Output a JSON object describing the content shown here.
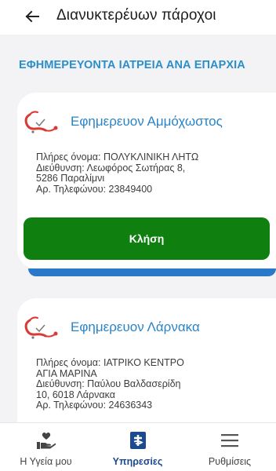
{
  "header": {
    "title": "Διανυκτερέυων πάροχοι"
  },
  "section": {
    "title": "ΕΦΗΜΕΡΕΥΟΝΤΑ ΙΑΤΡΕΙΑ ΑΝΑ ΕΠΑΡΧΙΑ"
  },
  "providers": [
    {
      "title": "Εφημερευον Αμμόχωστος",
      "info": [
        "Πλήρες όνομα: ΠΟΛΥΚΛΙΝΙΚΗ ΛΗΤΩ",
        "Διεύθυνση: Λεωφόρος Σωτήρας 8,",
        "5286 Παραλίμνι",
        "Αρ. Τηλεφώνου: 23849400"
      ],
      "call_label": "Κλήση"
    },
    {
      "title": "Εφημερευον Λάρνακα",
      "info": [
        "Πλήρες όνομα: ΙΑΤΡΙΚΟ ΚΕΝΤΡΟ",
        "ΑΓΙΑ ΜΑΡΙΝΑ",
        "Διεύθυνση: Παύλου Βαλδασερίδη",
        "10, 6018 Λάρνακα",
        "Αρ. Τηλεφώνου: 24636343"
      ]
    }
  ],
  "nav": {
    "items": [
      {
        "label": "Η Υγεία μου",
        "icon": "hand-heart-icon",
        "active": false
      },
      {
        "label": "Υπηρεσίες",
        "icon": "medical-services-icon",
        "active": true
      },
      {
        "label": "Ρυθμίσεις",
        "icon": "menu-icon",
        "active": false
      }
    ]
  },
  "colors": {
    "accent": "#2a8fc9",
    "call_button": "#0f800f",
    "nav_active": "#1d4a8f",
    "logo_red": "#d93a35"
  }
}
